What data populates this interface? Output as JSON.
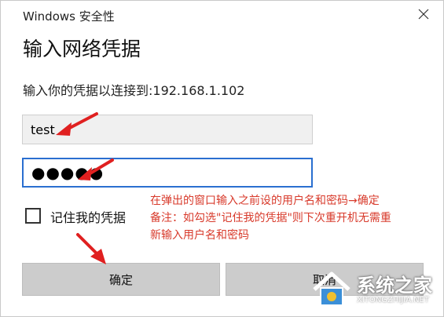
{
  "window": {
    "title": "Windows 安全性",
    "close_icon": "close-icon"
  },
  "dialog": {
    "heading": "输入网络凭据",
    "subtitle": "输入你的凭据以连接到:192.168.1.102",
    "username_value": "test",
    "password_mask": "●●●●●",
    "remember_label": "记住我的凭据",
    "remember_checked": false
  },
  "buttons": {
    "ok_label": "确定",
    "cancel_label": "取消"
  },
  "annotation": {
    "lines": [
      "在弹出的窗口输入之前设的用户名和密码→确定",
      "备注：如勾选\"记住我的凭据\"则下次重开机无需重",
      "新输入用户名和密码"
    ],
    "color": "#d83a2b"
  },
  "watermark": {
    "title": "系统之家",
    "url": "XITONGZHIJIA.NET"
  },
  "colors": {
    "accent_border": "#2a6fd0",
    "button_bg": "#cccccc",
    "arrow_red": "#e02020"
  }
}
